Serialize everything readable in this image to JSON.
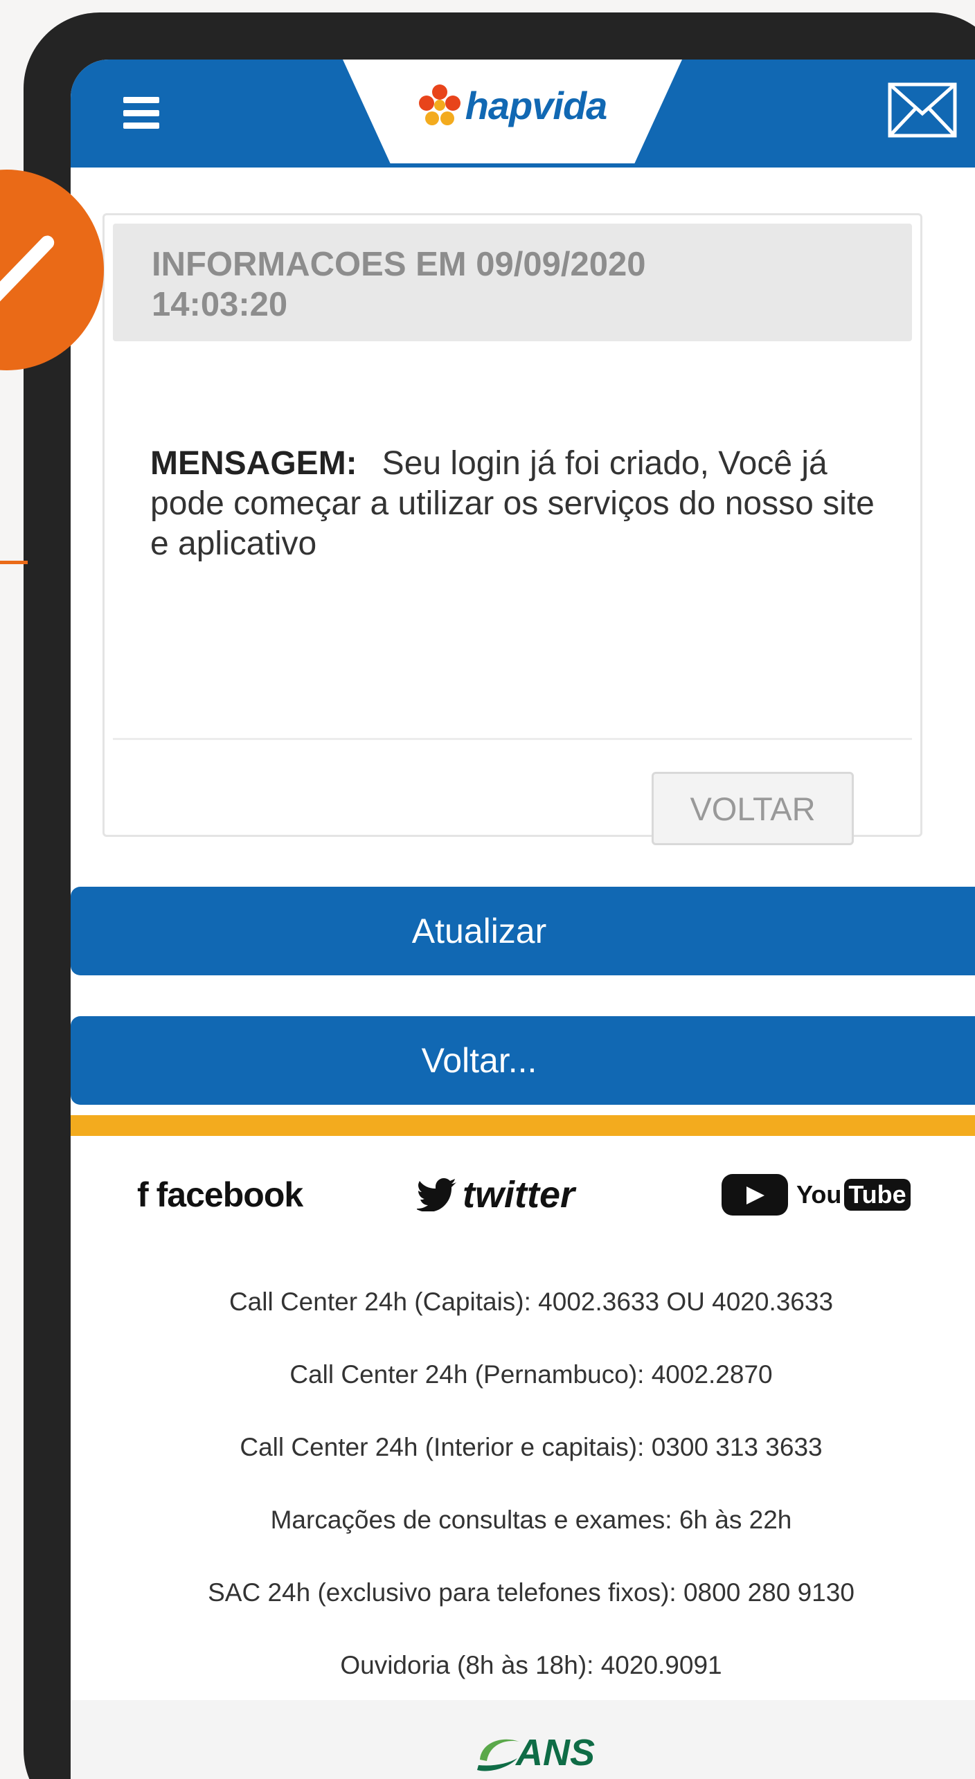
{
  "header": {
    "menu_icon": "hamburger-menu-icon",
    "logo_text": "hapvida",
    "logo_icon": "flower-logo-icon",
    "mail_icon": "envelope-icon"
  },
  "card": {
    "title_line1": "INFORMACOES EM 09/09/2020",
    "title_line2": "14:03:20",
    "message_label": "MENSAGEM:",
    "message_text": "Seu login já foi criado, Você já pode começar a utilizar os serviços do nosso site e aplicativo",
    "back_button": "VOLTAR"
  },
  "actions": {
    "update_button": "Atualizar",
    "back_button": "Voltar..."
  },
  "social": {
    "facebook": "facebook",
    "twitter": "twitter",
    "youtube_you": "You",
    "youtube_tube": "Tube"
  },
  "footer": {
    "lines": [
      "Call Center 24h (Capitais): 4002.3633 OU 4020.3633",
      "Call Center 24h (Pernambuco): 4002.2870",
      "Call Center 24h (Interior e capitais): 0300 313 3633",
      "Marcações de consultas e exames: 6h às 22h",
      "SAC 24h (exclusivo para telefones fixos): 0800 280 9130",
      "Ouvidoria (8h às 18h): 4020.9091"
    ],
    "ans_logo": "ANS"
  },
  "colors": {
    "brand_blue": "#1168b3",
    "accent_orange": "#ea6a17",
    "footer_yellow": "#f3ab1e"
  }
}
